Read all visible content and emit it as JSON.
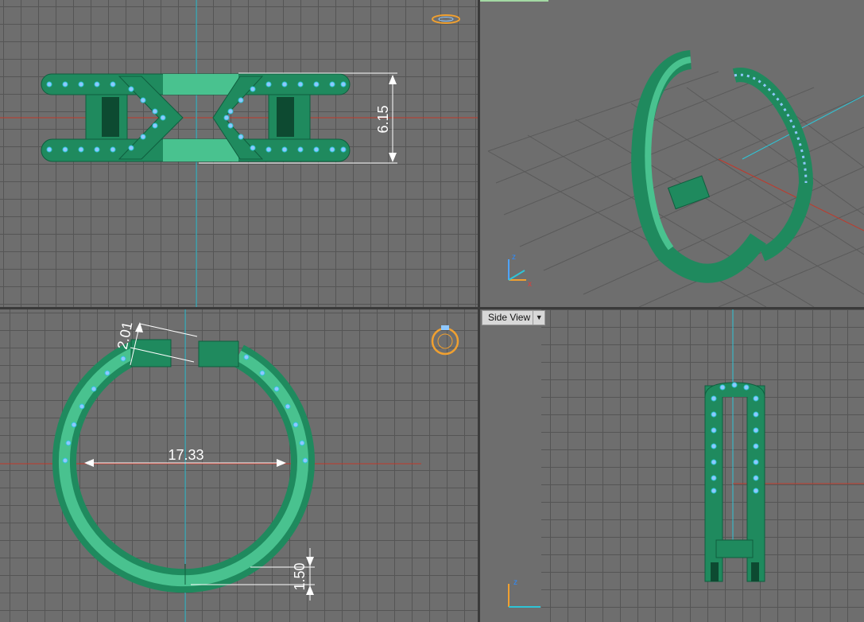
{
  "viewports": {
    "top": {
      "dimension_height": "6.15"
    },
    "perspective": {
      "axis_z": "z",
      "axis_x": "x"
    },
    "front": {
      "dimension_diameter": "17.33",
      "dimension_gap": "2.01",
      "dimension_band": "1.50"
    },
    "side": {
      "view_label": "Side View",
      "view_dropdown_icon": "chevron-down-icon",
      "axis_z": "z"
    }
  },
  "colors": {
    "viewport_bg": "#6e6e6e",
    "grid_line": "#555555",
    "ring_green": "#1f8a5e",
    "ring_light": "#49c28f",
    "stone_blue": "#8fc8ff",
    "axis_red": "#c0392b",
    "axis_cyan": "#2ec4d6",
    "gizmo_orange": "#f0a030"
  }
}
